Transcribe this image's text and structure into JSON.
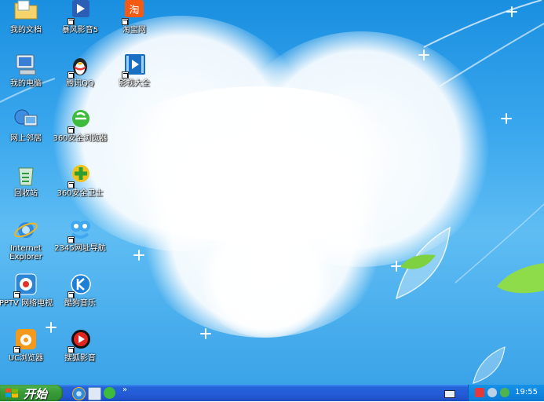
{
  "desktop": {
    "icons": [
      {
        "label": "我的文档"
      },
      {
        "label": "暴风影音5"
      },
      {
        "label": "淘宝网"
      },
      {
        "label": "我的电脑"
      },
      {
        "label": "腾讯QQ"
      },
      {
        "label": "影视大全"
      },
      {
        "label": "网上邻居"
      },
      {
        "label": "360安全浏览器"
      },
      {
        "label": "回收站"
      },
      {
        "label": "360安全卫士"
      },
      {
        "label": "Internet Explorer"
      },
      {
        "label": "2345网址导航"
      },
      {
        "label": "PPTV 网络电视"
      },
      {
        "label": "酷狗音乐"
      },
      {
        "label": "UC浏览器"
      },
      {
        "label": "搜狐影音"
      }
    ]
  },
  "taskbar": {
    "start_label": "开始",
    "chevron": "»",
    "clock": "19:55"
  }
}
